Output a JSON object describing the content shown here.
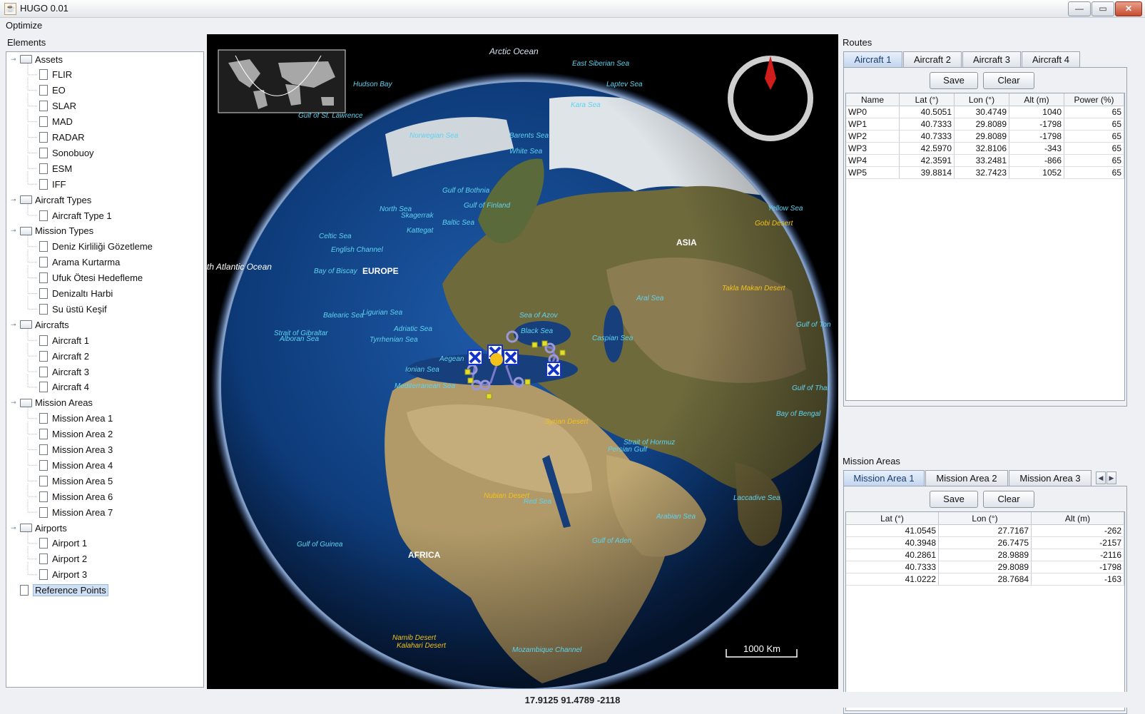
{
  "window": {
    "title": "HUGO 0.01",
    "controls": [
      "—",
      "▭",
      "✕"
    ]
  },
  "menu": {
    "items": [
      "Optimize"
    ]
  },
  "elements_panel": {
    "title": "Elements",
    "tree": [
      {
        "label": "Assets",
        "level": 0,
        "type": "folder"
      },
      {
        "label": "FLIR",
        "level": 1,
        "type": "leaf"
      },
      {
        "label": "EO",
        "level": 1,
        "type": "leaf"
      },
      {
        "label": "SLAR",
        "level": 1,
        "type": "leaf"
      },
      {
        "label": "MAD",
        "level": 1,
        "type": "leaf"
      },
      {
        "label": "RADAR",
        "level": 1,
        "type": "leaf"
      },
      {
        "label": "Sonobuoy",
        "level": 1,
        "type": "leaf"
      },
      {
        "label": "ESM",
        "level": 1,
        "type": "leaf"
      },
      {
        "label": "IFF",
        "level": 1,
        "type": "leaf"
      },
      {
        "label": "Aircraft Types",
        "level": 0,
        "type": "folder"
      },
      {
        "label": "Aircraft Type 1",
        "level": 1,
        "type": "leaf"
      },
      {
        "label": "Mission Types",
        "level": 0,
        "type": "folder"
      },
      {
        "label": "Deniz Kirliliği Gözetleme",
        "level": 1,
        "type": "leaf"
      },
      {
        "label": "Arama Kurtarma",
        "level": 1,
        "type": "leaf"
      },
      {
        "label": "Ufuk Ötesi Hedefleme",
        "level": 1,
        "type": "leaf"
      },
      {
        "label": "Denizaltı Harbi",
        "level": 1,
        "type": "leaf"
      },
      {
        "label": "Su üstü Keşif",
        "level": 1,
        "type": "leaf"
      },
      {
        "label": "Aircrafts",
        "level": 0,
        "type": "folder"
      },
      {
        "label": "Aircraft 1",
        "level": 1,
        "type": "leaf"
      },
      {
        "label": "Aircraft 2",
        "level": 1,
        "type": "leaf"
      },
      {
        "label": "Aircraft 3",
        "level": 1,
        "type": "leaf"
      },
      {
        "label": "Aircraft 4",
        "level": 1,
        "type": "leaf"
      },
      {
        "label": "Mission Areas",
        "level": 0,
        "type": "folder"
      },
      {
        "label": "Mission Area 1",
        "level": 1,
        "type": "leaf"
      },
      {
        "label": "Mission Area 2",
        "level": 1,
        "type": "leaf"
      },
      {
        "label": "Mission Area 3",
        "level": 1,
        "type": "leaf"
      },
      {
        "label": "Mission Area 4",
        "level": 1,
        "type": "leaf"
      },
      {
        "label": "Mission Area 5",
        "level": 1,
        "type": "leaf"
      },
      {
        "label": "Mission Area 6",
        "level": 1,
        "type": "leaf"
      },
      {
        "label": "Mission Area 7",
        "level": 1,
        "type": "leaf"
      },
      {
        "label": "Airports",
        "level": 0,
        "type": "folder"
      },
      {
        "label": "Airport 1",
        "level": 1,
        "type": "leaf"
      },
      {
        "label": "Airport 2",
        "level": 1,
        "type": "leaf"
      },
      {
        "label": "Airport 3",
        "level": 1,
        "type": "leaf"
      },
      {
        "label": "Reference Points",
        "level": 0,
        "type": "leaf",
        "selected": true
      }
    ]
  },
  "map": {
    "scale_label": "1000 Km",
    "labels": {
      "arctic": "Arctic Ocean",
      "east_siberian": "East Siberian Sea",
      "hudson": "Hudson Bay",
      "laptev": "Laptev Sea",
      "kara": "Kara Sea",
      "st_lawrence": "Gulf of St. Lawrence",
      "norwegian": "Norwegian Sea",
      "barents": "Barents Sea",
      "white": "White Sea",
      "bothnia": "Gulf of Bothnia",
      "finland": "Gulf of Finland",
      "north_sea": "North Sea",
      "skagerrak": "Skagerrak",
      "kattegat": "Kattegat",
      "baltic": "Baltic Sea",
      "yellow": "Yellow Sea",
      "gobi": "Gobi Desert",
      "celtic": "Celtic Sea",
      "english": "English Channel",
      "asia": "ASIA",
      "atlantic": "th Atlantic Ocean",
      "biscay": "Bay of Biscay",
      "europe": "EUROPE",
      "aral": "Aral Sea",
      "taklamakan": "Takla Makan Desert",
      "balearic": "Balearic Sea",
      "ligurian": "Ligurian Sea",
      "azov": "Sea of Azov",
      "gibraltar": "Strait of Gibraltar",
      "alboran": "Alboran Sea",
      "adriatic": "Adriatic Sea",
      "black": "Black Sea",
      "tyrrhenian": "Tyrrhenian Sea",
      "caspian": "Caspian Sea",
      "aegean": "Aegean",
      "ionian": "Ionian Sea",
      "mediterranean": "Mediterranean Sea",
      "gulf_ton": "Gulf of Ton",
      "gulf_thai": "Gulf of Thai",
      "bengal": "Bay of Bengal",
      "syrian": "Syrian Desert",
      "hormuz": "Strait of Hormuz",
      "persian": "Persian Gulf",
      "nubian": "Nubian Desert",
      "red": "Red Sea",
      "laccadive": "Laccadive Sea",
      "arabian": "Arabian Sea",
      "guinea": "Gulf of Guinea",
      "aden": "Gulf of Aden",
      "africa": "AFRICA",
      "namib": "Namib Desert",
      "kalahari": "Kalahari Desert",
      "mozambique": "Mozambique Channel"
    }
  },
  "routes": {
    "title": "Routes",
    "tabs": [
      "Aircraft 1",
      "Aircraft 2",
      "Aircraft 3",
      "Aircraft 4"
    ],
    "active_tab": 0,
    "save_label": "Save",
    "clear_label": "Clear",
    "columns": [
      "Name",
      "Lat (°)",
      "Lon (°)",
      "Alt (m)",
      "Power (%)"
    ],
    "rows": [
      [
        "WP0",
        "40.5051",
        "30.4749",
        "1040",
        "65"
      ],
      [
        "WP1",
        "40.7333",
        "29.8089",
        "-1798",
        "65"
      ],
      [
        "WP2",
        "40.7333",
        "29.8089",
        "-1798",
        "65"
      ],
      [
        "WP3",
        "42.5970",
        "32.8106",
        "-343",
        "65"
      ],
      [
        "WP4",
        "42.3591",
        "33.2481",
        "-866",
        "65"
      ],
      [
        "WP5",
        "39.8814",
        "32.7423",
        "1052",
        "65"
      ]
    ]
  },
  "mission_areas": {
    "title": "Mission Areas",
    "tabs": [
      "Mission Area 1",
      "Mission Area 2",
      "Mission Area 3"
    ],
    "active_tab": 0,
    "save_label": "Save",
    "clear_label": "Clear",
    "columns": [
      "Lat (°)",
      "Lon (°)",
      "Alt (m)"
    ],
    "rows": [
      [
        "41.0545",
        "27.7167",
        "-262"
      ],
      [
        "40.3948",
        "26.7475",
        "-2157"
      ],
      [
        "40.2861",
        "28.9889",
        "-2116"
      ],
      [
        "40.7333",
        "29.8089",
        "-1798"
      ],
      [
        "41.0222",
        "28.7684",
        "-163"
      ]
    ]
  },
  "status": {
    "coordinates": "17.9125 91.4789 -2118"
  },
  "colors": {
    "accent": "#c3d6ee",
    "ocean": "#0d3a78",
    "land": "#8a7a4a",
    "route": "#7b79c9",
    "marker": "#1433c8",
    "mission_area": "#c8c41e"
  }
}
